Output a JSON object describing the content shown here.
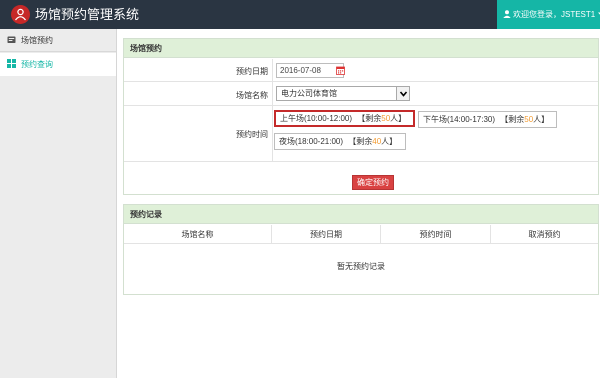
{
  "app": {
    "title": "场馆预约管理系统",
    "logo_icon": "user-circle-logo-icon",
    "accent": "#15b6a6",
    "brand_red": "#c62828"
  },
  "user": {
    "welcome": "欢迎您登录，JSTEST1",
    "dropdown_icon": "caret-down-icon"
  },
  "sidebar": {
    "items": [
      {
        "label": "场馆预约",
        "icon": "reservation-card-icon"
      },
      {
        "label": "预约查询",
        "icon": "grid-icon"
      }
    ]
  },
  "booking_panel": {
    "title": "场馆预约",
    "date_label": "预约日期",
    "date_value": "2016-07-08",
    "venue_label": "场馆名称",
    "venue_value": "电力公司体育馆",
    "time_label": "预约时间",
    "slots": [
      {
        "name": "上午场(10:00-12:00)",
        "remain_prefix": "【剩余",
        "remain": "50",
        "remain_suffix": "人】",
        "selected": true
      },
      {
        "name": "下午场(14:00-17:30)",
        "remain_prefix": "【剩余",
        "remain": "50",
        "remain_suffix": "人】",
        "selected": false
      },
      {
        "name": "夜场(18:00-21:00)",
        "remain_prefix": "【剩余",
        "remain": "40",
        "remain_suffix": "人】",
        "selected": false
      }
    ],
    "confirm_label": "确定预约"
  },
  "records_panel": {
    "title": "预约记录",
    "columns": [
      "场馆名称",
      "预约日期",
      "预约时间",
      "取消预约"
    ],
    "empty_text": "暂无预约记录"
  }
}
